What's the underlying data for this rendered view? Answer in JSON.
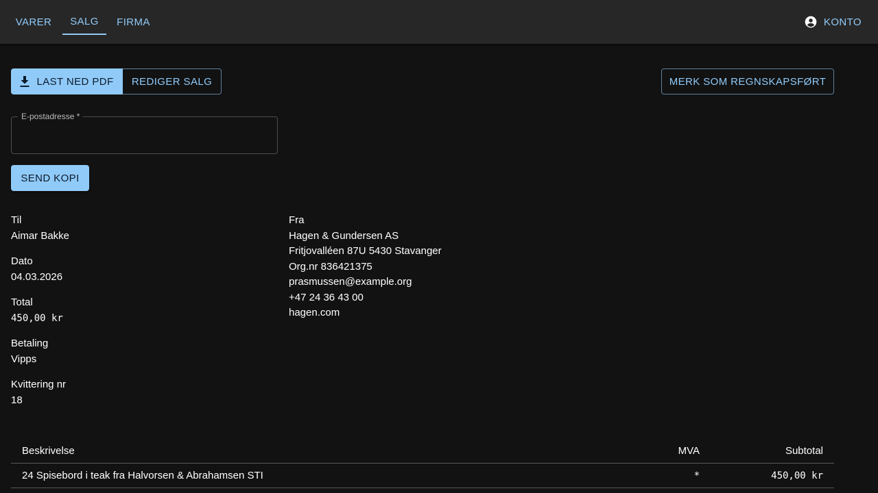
{
  "nav": {
    "tabs": [
      {
        "label": "VARER"
      },
      {
        "label": "SALG"
      },
      {
        "label": "FIRMA"
      }
    ],
    "active_tab": "SALG",
    "account_label": "KONTO",
    "accent_color": "#90caf9"
  },
  "toolbar": {
    "download_pdf_label": "LAST NED PDF",
    "edit_sale_label": "REDIGER SALG",
    "mark_accounted_label": "MERK SOM REGNSKAPSFØRT"
  },
  "email_form": {
    "label": "E-postadresse *",
    "value": "",
    "send_copy_label": "SEND KOPI"
  },
  "details": {
    "to_label": "Til",
    "to_value": "Aimar Bakke",
    "date_label": "Dato",
    "date_value": "04.03.2026",
    "total_label": "Total",
    "total_value": "450,00 kr",
    "payment_label": "Betaling",
    "payment_value": "Vipps",
    "receipt_label": "Kvittering nr",
    "receipt_value": "18"
  },
  "from": {
    "label": "Fra",
    "company": "Hagen & Gundersen AS",
    "address": "Fritjovalléen 87U 5430 Stavanger",
    "org_nr": "Org.nr 836421375",
    "email": "prasmussen@example.org",
    "phone": "+47 24 36 43 00",
    "website": "hagen.com"
  },
  "table": {
    "headers": {
      "description": "Beskrivelse",
      "vat": "MVA",
      "subtotal": "Subtotal"
    },
    "rows": [
      {
        "description": "24 Spisebord i teak fra Halvorsen & Abrahamsen STI",
        "vat": "*",
        "subtotal": "450,00 kr"
      }
    ]
  }
}
